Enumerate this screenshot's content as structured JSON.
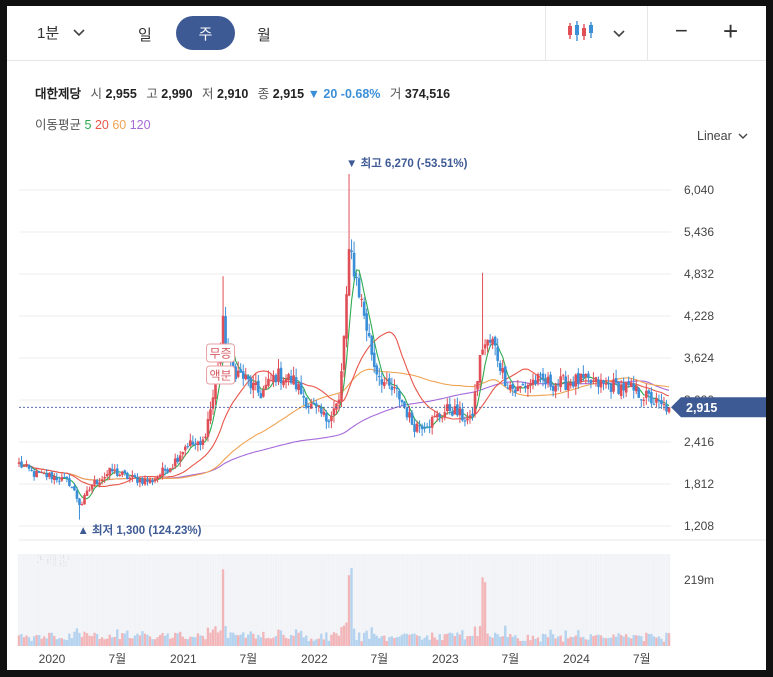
{
  "toolbar": {
    "period": "1분",
    "tabs": [
      "일",
      "주",
      "월"
    ],
    "active_tab": "주",
    "zoom_out": "−",
    "zoom_in": "+",
    "chevron": "⌄",
    "candle_icon": "candlestick-icon"
  },
  "stock": {
    "name": "대한제당",
    "open_label": "시",
    "open": "2,955",
    "high_label": "고",
    "high": "2,990",
    "low_label": "저",
    "low": "2,910",
    "close_label": "종",
    "close": "2,915",
    "change": "▼ 20 -0.68%",
    "volume_label": "거",
    "volume": "374,516"
  },
  "ma": {
    "label": "이동평균",
    "periods": [
      "5",
      "20",
      "60",
      "120"
    ],
    "colors": [
      "#2eaa4f",
      "#e8564a",
      "#f0a352",
      "#a66ad8"
    ]
  },
  "scale": "Linear",
  "colors": {
    "up": "#e04f57",
    "down": "#3b8fd8",
    "accent": "#3e5a95"
  },
  "chart_data": {
    "type": "candlestick",
    "price_ticks": [
      "6,040",
      "5,436",
      "4,832",
      "4,228",
      "3,624",
      "3,020",
      "2,416",
      "1,812",
      "1,208"
    ],
    "x_ticks": [
      "2020",
      "7월",
      "2021",
      "7월",
      "2022",
      "7월",
      "2023",
      "7월",
      "2024",
      "7월"
    ],
    "ylim": [
      1208,
      6270
    ],
    "high_annotation": "▼ 최고 6,270 (-53.51%)",
    "low_annotation": "▲ 최저 1,300 (124.23%)",
    "current_price": "2,915",
    "event_labels": [
      "무증",
      "액분"
    ],
    "volume_label": "거래량",
    "volume_tick": "219m",
    "anchors": [
      [
        "2019-10-01",
        2100
      ],
      [
        "2019-11-15",
        1950
      ],
      [
        "2020-01-05",
        1920
      ],
      [
        "2020-02-20",
        1830
      ],
      [
        "2020-03-20",
        1500
      ],
      [
        "2020-04-20",
        1800
      ],
      [
        "2020-06-15",
        2000
      ],
      [
        "2020-08-01",
        1900
      ],
      [
        "2020-10-01",
        1850
      ],
      [
        "2020-12-01",
        2100
      ],
      [
        "2021-01-10",
        2400
      ],
      [
        "2021-02-20",
        2350
      ],
      [
        "2021-03-25",
        3100
      ],
      [
        "2021-04-20",
        4100
      ],
      [
        "2021-05-10",
        3500
      ],
      [
        "2021-06-15",
        3350
      ],
      [
        "2021-08-01",
        3100
      ],
      [
        "2021-09-15",
        3380
      ],
      [
        "2021-11-01",
        3300
      ],
      [
        "2021-12-15",
        2950
      ],
      [
        "2022-02-01",
        2750
      ],
      [
        "2022-03-10",
        3000
      ],
      [
        "2022-04-07",
        5200
      ],
      [
        "2022-04-20",
        4900
      ],
      [
        "2022-05-15",
        4300
      ],
      [
        "2022-06-15",
        3500
      ],
      [
        "2022-07-20",
        3200
      ],
      [
        "2022-08-20",
        3100
      ],
      [
        "2022-10-01",
        2650
      ],
      [
        "2022-11-15",
        2700
      ],
      [
        "2023-01-10",
        2900
      ],
      [
        "2023-03-10",
        2700
      ],
      [
        "2023-04-10",
        3800
      ],
      [
        "2023-05-10",
        3850
      ],
      [
        "2023-06-10",
        3350
      ],
      [
        "2023-07-10",
        3150
      ],
      [
        "2023-09-01",
        3300
      ],
      [
        "2023-11-01",
        3250
      ],
      [
        "2024-01-01",
        3300
      ],
      [
        "2024-03-01",
        3250
      ],
      [
        "2024-05-15",
        3200
      ],
      [
        "2024-07-15",
        3050
      ],
      [
        "2024-08-20",
        2920
      ],
      [
        "2024-09-15",
        2915
      ]
    ]
  }
}
